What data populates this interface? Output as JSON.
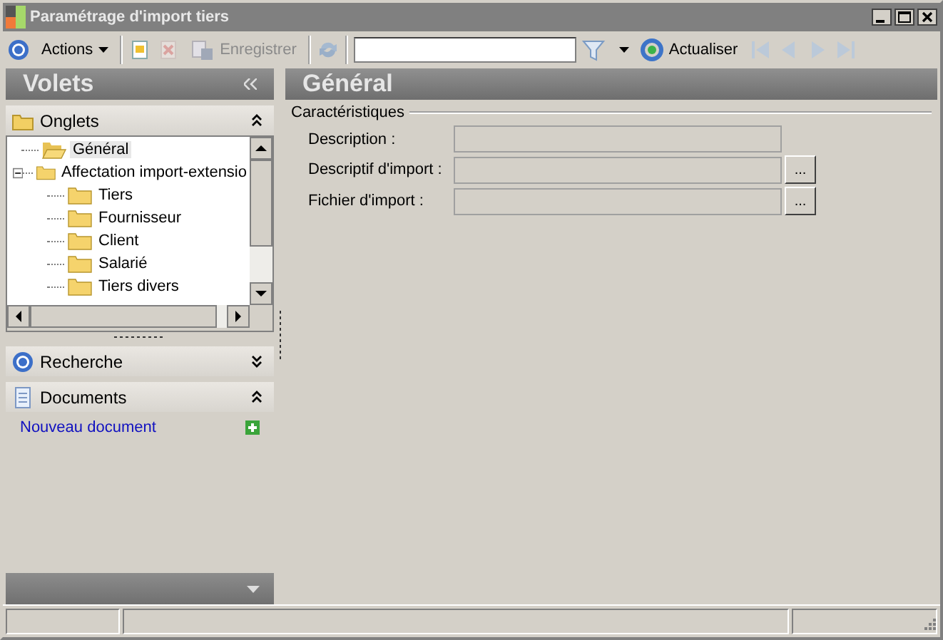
{
  "window": {
    "title": "Paramétrage d'import tiers"
  },
  "toolbar": [
    {
      "kind": "icon",
      "disabled": false
    },
    {
      "kind": "menu",
      "label": "Actions",
      "disabled": false
    },
    {
      "kind": "sep"
    },
    {
      "kind": "icon",
      "disabled": false
    },
    {
      "kind": "icon",
      "disabled": true
    },
    {
      "kind": "button",
      "label": "Enregistrer",
      "disabled": true
    },
    {
      "kind": "sep"
    },
    {
      "kind": "icon",
      "disabled": true
    },
    {
      "kind": "sep"
    },
    {
      "kind": "search"
    },
    {
      "kind": "icon",
      "disabled": false
    },
    {
      "kind": "caret"
    },
    {
      "kind": "button",
      "label": "Actualiser",
      "disabled": false
    },
    {
      "kind": "icon",
      "disabled": true
    },
    {
      "kind": "icon",
      "disabled": true
    },
    {
      "kind": "icon",
      "disabled": true
    },
    {
      "kind": "icon",
      "disabled": true
    }
  ],
  "sidebar": {
    "title": "Volets",
    "sections": [
      {
        "title": "Onglets",
        "expanded": true,
        "tree": [
          {
            "label": "Général",
            "selected": true
          },
          {
            "label": "Affectation import-extensio",
            "selected": false,
            "expanded": true,
            "children": [
              {
                "label": "Tiers",
                "selected": false
              },
              {
                "label": "Fournisseur",
                "selected": false
              },
              {
                "label": "Client",
                "selected": false
              },
              {
                "label": "Salarié",
                "selected": false
              },
              {
                "label": "Tiers divers",
                "selected": false
              }
            ]
          }
        ]
      },
      {
        "title": "Recherche",
        "expanded": false
      },
      {
        "title": "Documents",
        "expanded": true,
        "links": [
          {
            "label": "Nouveau document"
          }
        ]
      }
    ]
  },
  "main": {
    "title": "Général",
    "group": "Caractéristiques",
    "fields": [
      {
        "label": "Description :"
      },
      {
        "label": "Descriptif d'import :",
        "button": "..."
      },
      {
        "label": "Fichier d'import :",
        "button": "..."
      }
    ]
  }
}
